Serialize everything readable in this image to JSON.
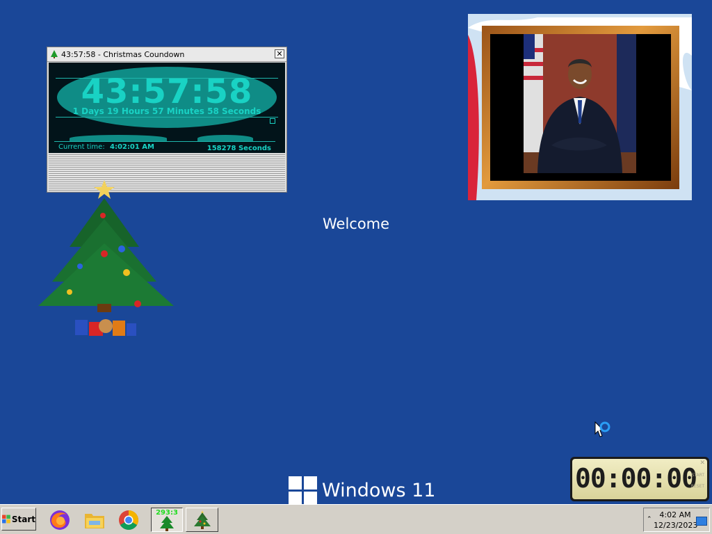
{
  "countdown_window": {
    "title": "43:57:58 - Christmas Coundown",
    "close_label": "✕",
    "big_time": "43:57:58",
    "words": "1 Days 19 Hours 57 Minutes 58 Seconds",
    "current_time_label": "Current time:",
    "current_time_value": "4:02:01 AM",
    "seconds_value": "158278 Seconds"
  },
  "desktop": {
    "welcome": "Welcome",
    "windows_text": "Windows 11"
  },
  "stopwatch": {
    "digits": "00:00:00",
    "start_label": "START",
    "reset_label": "RESET",
    "close_label": "✕"
  },
  "taskbar": {
    "start_label": "Start",
    "countdown_badge": "293:3",
    "clock_time": "4:02 AM",
    "clock_date": "12/23/2023",
    "tray_chevron": "⌃",
    "apps": [
      {
        "name": "firefox-icon"
      },
      {
        "name": "file-explorer-icon"
      },
      {
        "name": "chrome-icon"
      },
      {
        "name": "christmas-countdown-icon"
      },
      {
        "name": "christmas-tree-app-icon"
      }
    ]
  },
  "colors": {
    "desktop_bg": "#1a4798",
    "taskbar_bg": "#d4d0c8",
    "countdown_teal": "#19d2c4",
    "stopwatch_face": "#e6e1ae"
  }
}
